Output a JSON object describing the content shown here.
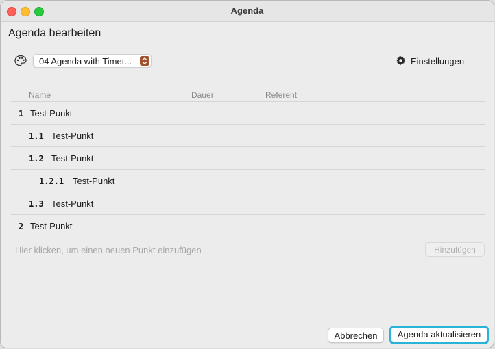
{
  "window": {
    "title": "Agenda"
  },
  "heading": "Agenda bearbeiten",
  "toolbar": {
    "palette_icon": "palette-icon",
    "template_select": "04 Agenda with Timet...",
    "settings_icon": "gear-icon",
    "settings_label": "Einstellungen",
    "select_accent": "#a0522d"
  },
  "table": {
    "columns": [
      "Name",
      "Dauer",
      "Referent"
    ],
    "rows": [
      {
        "num": "1",
        "label": "Test-Punkt"
      },
      {
        "num": "1.1",
        "label": "Test-Punkt"
      },
      {
        "num": "1.2",
        "label": "Test-Punkt"
      },
      {
        "num": "1.2.1",
        "label": "Test-Punkt"
      },
      {
        "num": "1.3",
        "label": "Test-Punkt"
      },
      {
        "num": "2",
        "label": "Test-Punkt"
      }
    ]
  },
  "add_row": {
    "hint": "Hier klicken, um einen neuen Punkt einzufügen",
    "button": "Hinzufügen"
  },
  "footer": {
    "cancel": "Abbrechen",
    "primary": "Agenda aktualisieren",
    "primary_focus_color": "#29b3d8"
  }
}
